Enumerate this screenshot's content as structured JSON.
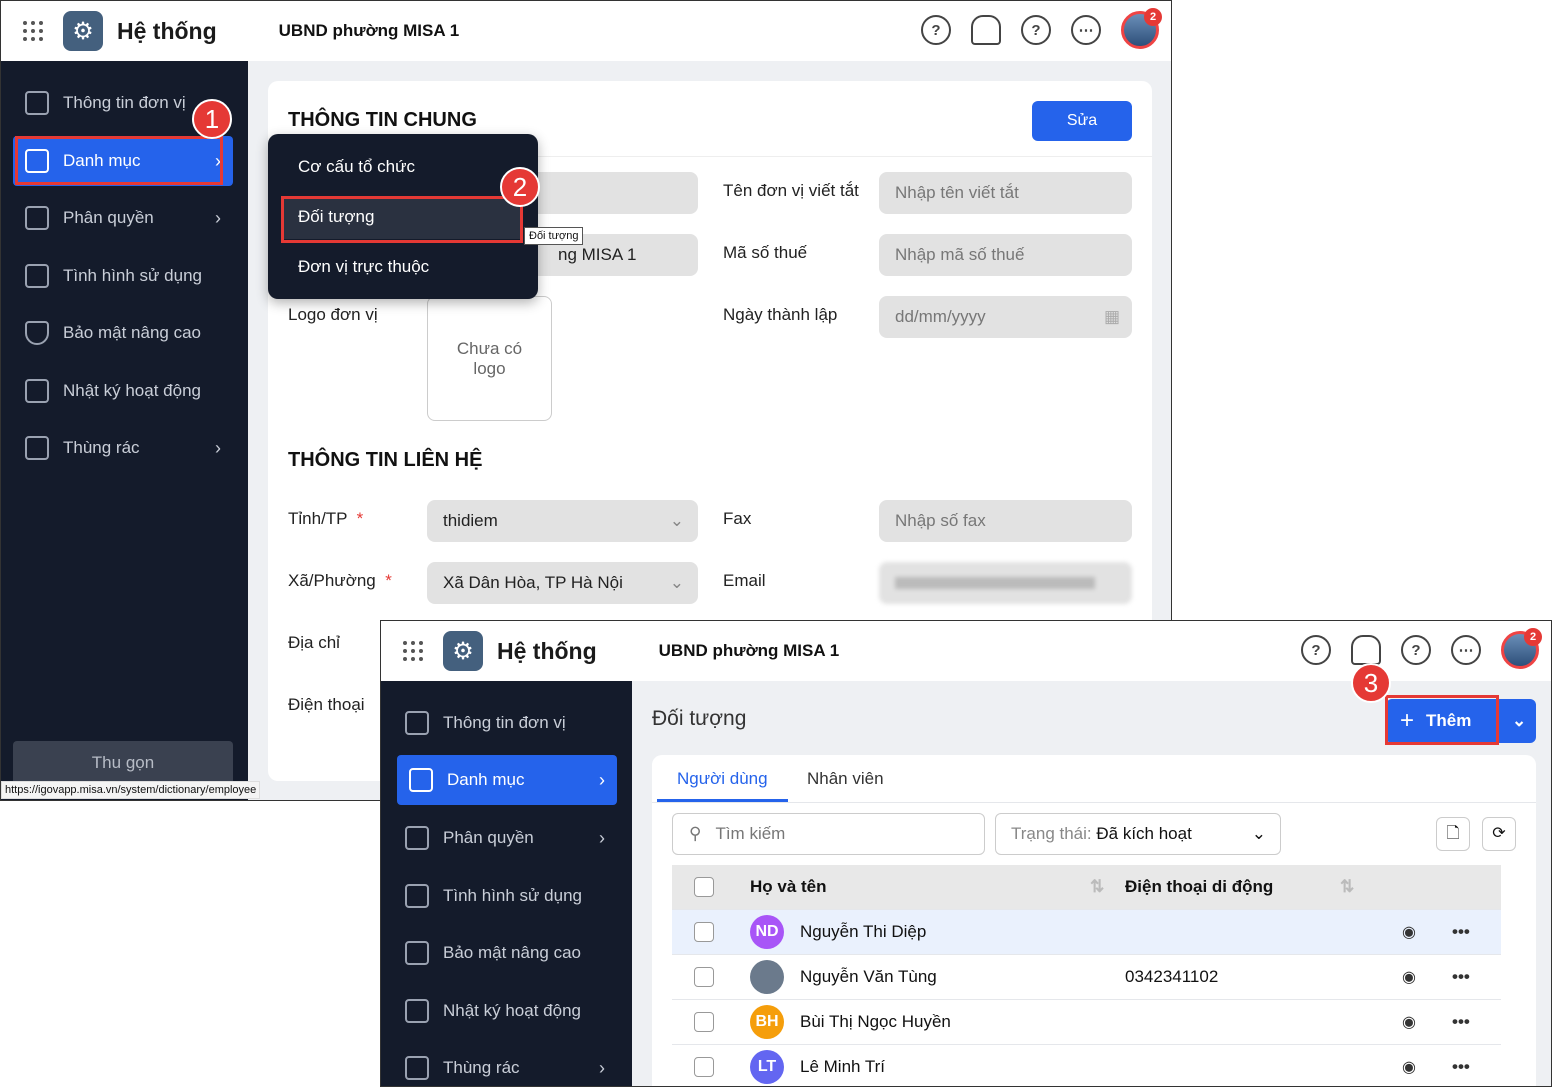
{
  "app": {
    "title": "Hệ thống",
    "org": "UBND phường MISA 1",
    "notif_count": "2"
  },
  "sidebar": {
    "items": [
      {
        "label": "Thông tin đơn vị"
      },
      {
        "label": "Danh mục"
      },
      {
        "label": "Phân quyền"
      },
      {
        "label": "Tình hình sử dụng"
      },
      {
        "label": "Bảo mật nâng cao"
      },
      {
        "label": "Nhật ký hoạt động"
      },
      {
        "label": "Thùng rác"
      }
    ],
    "collapse": "Thu gọn"
  },
  "submenu": {
    "items": [
      "Cơ cấu tổ chức",
      "Đối tượng",
      "Đơn vị trực thuộc"
    ],
    "tooltip": "Đối tượng"
  },
  "general": {
    "title": "THÔNG TIN CHUNG",
    "edit": "Sửa",
    "name_partial": "ng MISA 1",
    "abbr_label": "Tên đơn vị viết tắt",
    "abbr_ph": "Nhập tên viết tắt",
    "tax_label": "Mã số thuế",
    "tax_ph": "Nhập mã số thuế",
    "logo_label": "Logo đơn vị",
    "logo_empty": "Chưa có logo",
    "date_label": "Ngày thành lập",
    "date_ph": "dd/mm/yyyy"
  },
  "contact": {
    "title": "THÔNG TIN LIÊN HỆ",
    "province_label": "Tỉnh/TP",
    "province": "thidiem",
    "ward_label": "Xã/Phường",
    "ward": "Xã Dân Hòa, TP Hà Nội",
    "fax_label": "Fax",
    "fax_ph": "Nhập số fax",
    "email_label": "Email",
    "address_label": "Địa chỉ",
    "phone_label": "Điện thoại",
    "required": "*"
  },
  "status_url": "https://igovapp.misa.vn/system/dictionary/employee",
  "markers": [
    "1",
    "2",
    "3"
  ],
  "objects": {
    "title": "Đối tượng",
    "add": "Thêm",
    "tabs": [
      "Người dùng",
      "Nhân viên"
    ],
    "search_ph": "Tìm kiếm",
    "status_label": "Trạng thái:",
    "status_value": "Đã kích hoạt",
    "columns": [
      "Họ và tên",
      "Điện thoại di động"
    ],
    "rows": [
      {
        "initials": "ND",
        "name": "Nguyễn Thi Diệp",
        "phone": "",
        "color": "#a855f7"
      },
      {
        "initials": "",
        "name": "Nguyễn Văn Tùng",
        "phone": "0342341102",
        "color": "#6b7a8c"
      },
      {
        "initials": "BH",
        "name": "Bùi Thị Ngọc Huyền",
        "phone": "",
        "color": "#f59e0b"
      },
      {
        "initials": "LT",
        "name": "Lê Minh Trí",
        "phone": "",
        "color": "#6366f1"
      }
    ]
  }
}
